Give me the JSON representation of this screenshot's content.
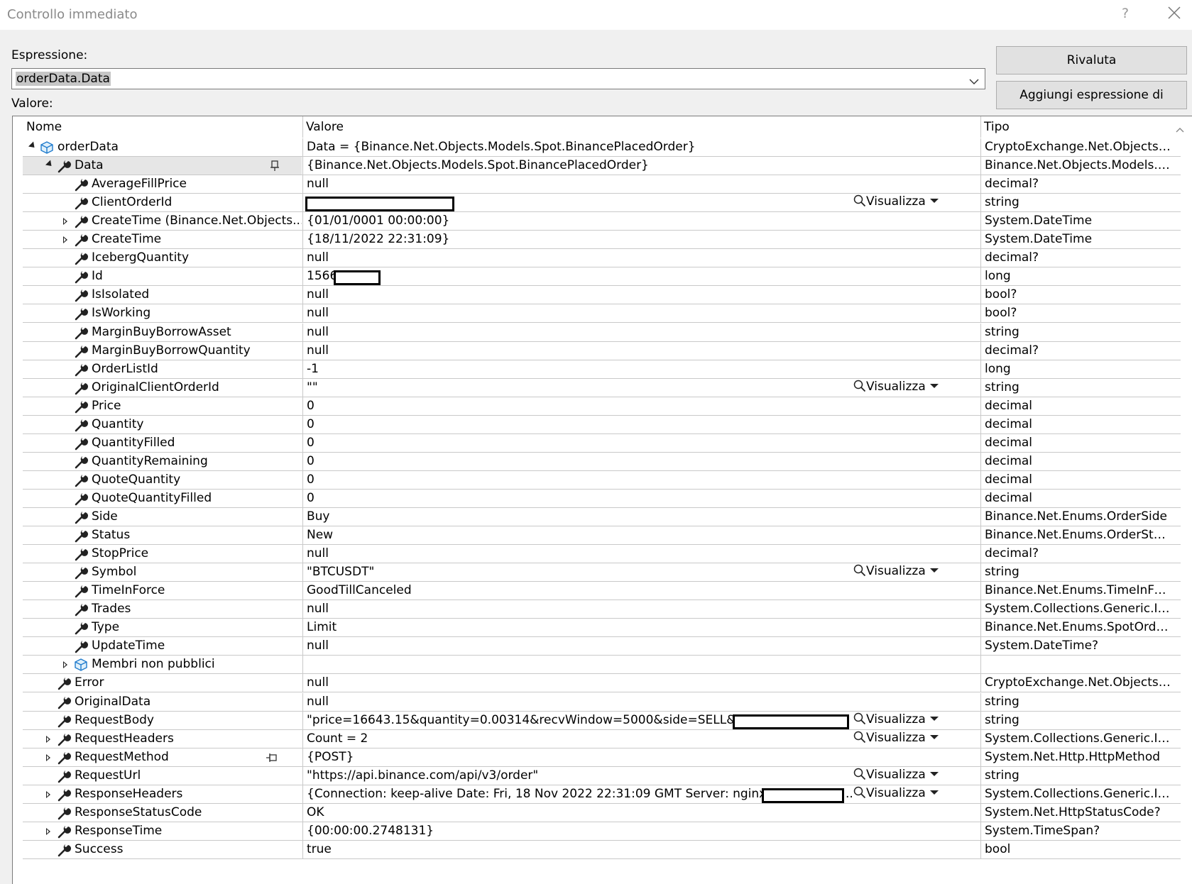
{
  "window": {
    "title": "Controllo immediato",
    "help": "?"
  },
  "expression": {
    "label": "Espressione:",
    "value": "orderData.Data"
  },
  "buttons": {
    "reevaluate": "Rivaluta",
    "add_watch": "Aggiungi espressione di controllo"
  },
  "value_label": "Valore:",
  "columns": {
    "name": "Nome",
    "value": "Valore",
    "type": "Tipo"
  },
  "visualize_label": "Visualizza",
  "rows": [
    {
      "name": "orderData",
      "value": "Data = {Binance.Net.Objects.Models.Spot.BinancePlacedOrder}",
      "type": "CryptoExchange.Net.Objects.W...",
      "level": 0,
      "expander": "open",
      "icon": "object-icon"
    },
    {
      "name": "Data",
      "value": "{Binance.Net.Objects.Models.Spot.BinancePlacedOrder}",
      "type": "Binance.Net.Objects.Models.Sp...",
      "level": 1,
      "expander": "open",
      "icon": "wrench-icon",
      "selected": true,
      "pin": "pin-icon"
    },
    {
      "name": "AverageFillPrice",
      "value": "null",
      "type": "decimal?",
      "level": 2,
      "icon": "wrench-icon"
    },
    {
      "name": "ClientOrderId",
      "value": "",
      "type": "string",
      "level": 2,
      "icon": "wrench-icon",
      "visualize": true,
      "redact": [
        0,
        210
      ]
    },
    {
      "name": "CreateTime (Binance.Net.Objects....",
      "value": "{01/01/0001 00:00:00}",
      "type": "System.DateTime",
      "level": 2,
      "expander": "closed",
      "icon": "wrench-icon"
    },
    {
      "name": "CreateTime",
      "value": "{18/11/2022 22:31:09}",
      "type": "System.DateTime",
      "level": 2,
      "expander": "closed",
      "icon": "wrench-icon"
    },
    {
      "name": "IcebergQuantity",
      "value": "null",
      "type": "decimal?",
      "level": 2,
      "icon": "wrench-icon"
    },
    {
      "name": "Id",
      "value": "1566",
      "type": "long",
      "level": 2,
      "icon": "wrench-icon",
      "redact": [
        40,
        66
      ]
    },
    {
      "name": "IsIsolated",
      "value": "null",
      "type": "bool?",
      "level": 2,
      "icon": "wrench-icon"
    },
    {
      "name": "IsWorking",
      "value": "null",
      "type": "bool?",
      "level": 2,
      "icon": "wrench-icon"
    },
    {
      "name": "MarginBuyBorrowAsset",
      "value": "null",
      "type": "string",
      "level": 2,
      "icon": "wrench-icon"
    },
    {
      "name": "MarginBuyBorrowQuantity",
      "value": "null",
      "type": "decimal?",
      "level": 2,
      "icon": "wrench-icon"
    },
    {
      "name": "OrderListId",
      "value": "-1",
      "type": "long",
      "level": 2,
      "icon": "wrench-icon"
    },
    {
      "name": "OriginalClientOrderId",
      "value": "\"\"",
      "type": "string",
      "level": 2,
      "icon": "wrench-icon",
      "visualize": true
    },
    {
      "name": "Price",
      "value": "0",
      "type": "decimal",
      "level": 2,
      "icon": "wrench-icon"
    },
    {
      "name": "Quantity",
      "value": "0",
      "type": "decimal",
      "level": 2,
      "icon": "wrench-icon"
    },
    {
      "name": "QuantityFilled",
      "value": "0",
      "type": "decimal",
      "level": 2,
      "icon": "wrench-icon"
    },
    {
      "name": "QuantityRemaining",
      "value": "0",
      "type": "decimal",
      "level": 2,
      "icon": "wrench-icon"
    },
    {
      "name": "QuoteQuantity",
      "value": "0",
      "type": "decimal",
      "level": 2,
      "icon": "wrench-icon"
    },
    {
      "name": "QuoteQuantityFilled",
      "value": "0",
      "type": "decimal",
      "level": 2,
      "icon": "wrench-icon"
    },
    {
      "name": "Side",
      "value": "Buy",
      "type": "Binance.Net.Enums.OrderSide",
      "level": 2,
      "icon": "wrench-icon"
    },
    {
      "name": "Status",
      "value": "New",
      "type": "Binance.Net.Enums.OrderStatus",
      "level": 2,
      "icon": "wrench-icon"
    },
    {
      "name": "StopPrice",
      "value": "null",
      "type": "decimal?",
      "level": 2,
      "icon": "wrench-icon"
    },
    {
      "name": "Symbol",
      "value": "\"BTCUSDT\"",
      "type": "string",
      "level": 2,
      "icon": "wrench-icon",
      "visualize": true
    },
    {
      "name": "TimeInForce",
      "value": "GoodTillCanceled",
      "type": "Binance.Net.Enums.TimeInForce",
      "level": 2,
      "icon": "wrench-icon"
    },
    {
      "name": "Trades",
      "value": "null",
      "type": "System.Collections.Generic.IEnu...",
      "level": 2,
      "icon": "wrench-icon"
    },
    {
      "name": "Type",
      "value": "Limit",
      "type": "Binance.Net.Enums.SpotOrderT...",
      "level": 2,
      "icon": "wrench-icon"
    },
    {
      "name": "UpdateTime",
      "value": "null",
      "type": "System.DateTime?",
      "level": 2,
      "icon": "wrench-icon"
    },
    {
      "name": "Membri non pubblici",
      "value": "",
      "type": "",
      "level": 2,
      "expander": "closed",
      "icon": "object-icon"
    },
    {
      "name": "Error",
      "value": "null",
      "type": "CryptoExchange.Net.Objects.Err...",
      "level": 1,
      "icon": "wrench-icon"
    },
    {
      "name": "OriginalData",
      "value": "null",
      "type": "string",
      "level": 1,
      "icon": "wrench-icon"
    },
    {
      "name": "RequestBody",
      "value": "\"price=16643.15&quantity=0.00314&recvWindow=5000&side=SELL&signature=",
      "type": "string",
      "level": 1,
      "icon": "wrench-icon",
      "visualize": true,
      "redact": [
        602,
        164
      ]
    },
    {
      "name": "RequestHeaders",
      "value": "Count = 2",
      "type": "System.Collections.Generic.IEnu...",
      "level": 1,
      "expander": "closed",
      "icon": "wrench-icon",
      "visualize": true
    },
    {
      "name": "RequestMethod",
      "value": "{POST}",
      "type": "System.Net.Http.HttpMethod",
      "level": 1,
      "expander": "closed",
      "icon": "wrench-icon",
      "pin": "unpin-icon"
    },
    {
      "name": "RequestUrl",
      "value": "\"https://api.binance.com/api/v3/order\"",
      "type": "string",
      "level": 1,
      "icon": "wrench-icon",
      "visualize": true
    },
    {
      "name": "ResponseHeaders",
      "value": "{Connection: keep-alive Date: Fri, 18 Nov 2022 22:31:09 GMT Server: nginxx-mbx-uuid: ",
      "type": "System.Collections.Generic.IEnu...",
      "level": 1,
      "expander": "closed",
      "icon": "wrench-icon",
      "visualize": true,
      "redact": [
        643,
        116
      ],
      "trail": ".."
    },
    {
      "name": "ResponseStatusCode",
      "value": "OK",
      "type": "System.Net.HttpStatusCode?",
      "level": 1,
      "icon": "wrench-icon"
    },
    {
      "name": "ResponseTime",
      "value": "{00:00:00.2748131}",
      "type": "System.TimeSpan?",
      "level": 1,
      "expander": "closed",
      "icon": "wrench-icon"
    },
    {
      "name": "Success",
      "value": "true",
      "type": "bool",
      "level": 1,
      "icon": "wrench-icon"
    }
  ]
}
